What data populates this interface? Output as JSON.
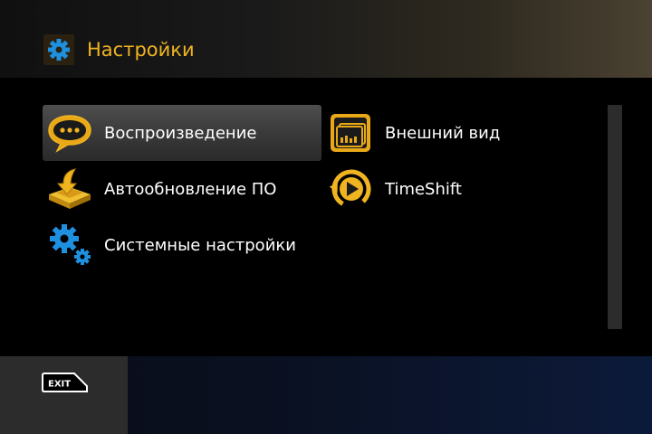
{
  "header": {
    "title": "Настройки",
    "icon": "gear-icon"
  },
  "menu": {
    "items": [
      {
        "label": "Воспроизведение",
        "icon": "speech-bubble-icon",
        "selected": true
      },
      {
        "label": "Внешний вид",
        "icon": "screen-appearance-icon",
        "selected": false
      },
      {
        "label": "Автообновление ПО",
        "icon": "software-update-icon",
        "selected": false
      },
      {
        "label": "TimeShift",
        "icon": "timeshift-icon",
        "selected": false
      },
      {
        "label": "Системные настройки",
        "icon": "system-gears-icon",
        "selected": false
      }
    ]
  },
  "footer": {
    "exit_label": "EXIT"
  },
  "colors": {
    "accent": "#f0b420",
    "gear_blue": "#1e90e0",
    "text": "#ffffff"
  }
}
